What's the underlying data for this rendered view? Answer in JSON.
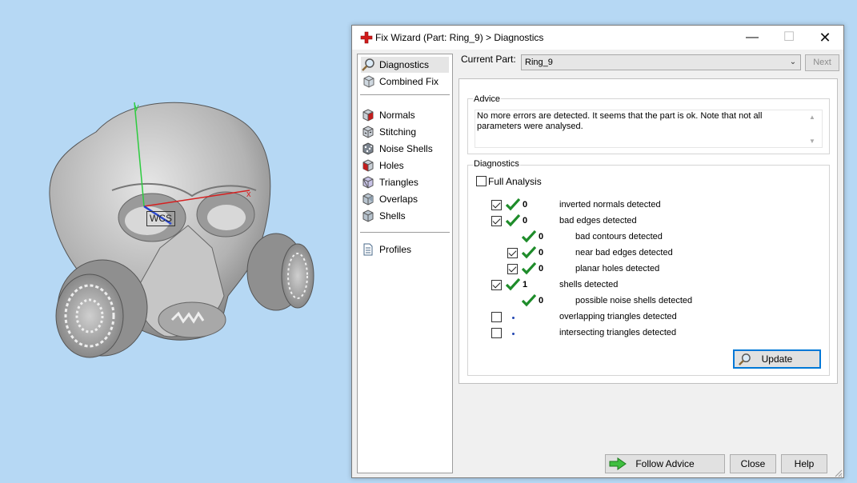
{
  "viewport": {
    "wcs_label": "WCS",
    "axis_x_label": "x",
    "axis_y_label": "y"
  },
  "dialog": {
    "title": "Fix Wizard (Part: Ring_9) > Diagnostics",
    "sidebar": {
      "group1": [
        {
          "label": "Diagnostics",
          "icon": "magnifier-icon",
          "selected": true
        },
        {
          "label": "Combined Fix",
          "icon": "cube-icon"
        }
      ],
      "group2": [
        {
          "label": "Normals",
          "icon": "normals-cube-icon"
        },
        {
          "label": "Stitching",
          "icon": "stitching-cube-icon"
        },
        {
          "label": "Noise Shells",
          "icon": "noise-shells-cube-icon"
        },
        {
          "label": "Holes",
          "icon": "holes-cube-icon"
        },
        {
          "label": "Triangles",
          "icon": "triangles-cube-icon"
        },
        {
          "label": "Overlaps",
          "icon": "overlaps-cube-icon"
        },
        {
          "label": "Shells",
          "icon": "shells-cube-icon"
        }
      ],
      "group3": [
        {
          "label": "Profiles",
          "icon": "document-icon"
        }
      ]
    },
    "current_part_label": "Current Part:",
    "current_part_value": "Ring_9",
    "next_label": "Next",
    "advice": {
      "title": "Advice",
      "text": "No more errors are detected. It seems that the part is ok. Note that not all parameters were analysed."
    },
    "diagnostics": {
      "title": "Diagnostics",
      "full_analysis_label": "Full Analysis",
      "full_analysis_checked": false,
      "rows": [
        {
          "label": "inverted normals detected",
          "count": "0",
          "status": "ok",
          "checkbox": true,
          "checked": true,
          "indent": 0
        },
        {
          "label": "bad edges detected",
          "count": "0",
          "status": "ok",
          "checkbox": true,
          "checked": true,
          "indent": 0
        },
        {
          "label": "bad contours detected",
          "count": "0",
          "status": "ok",
          "checkbox": false,
          "checked": false,
          "indent": 1
        },
        {
          "label": "near bad edges detected",
          "count": "0",
          "status": "ok",
          "checkbox": true,
          "checked": true,
          "indent": 1
        },
        {
          "label": "planar holes detected",
          "count": "0",
          "status": "ok",
          "checkbox": true,
          "checked": true,
          "indent": 1
        },
        {
          "label": "shells detected",
          "count": "1",
          "status": "ok",
          "checkbox": true,
          "checked": true,
          "indent": 0
        },
        {
          "label": "possible noise shells detected",
          "count": "0",
          "status": "ok",
          "checkbox": false,
          "checked": false,
          "indent": 1
        },
        {
          "label": "overlapping triangles detected",
          "count": "",
          "status": "pending",
          "checkbox": true,
          "checked": false,
          "indent": 0
        },
        {
          "label": "intersecting triangles detected",
          "count": "",
          "status": "pending",
          "checkbox": true,
          "checked": false,
          "indent": 0
        }
      ],
      "update_label": "Update"
    },
    "buttons": {
      "follow_advice": "Follow Advice",
      "close": "Close",
      "help": "Help"
    },
    "colors": {
      "check_green": "#1e8c2a",
      "accent_blue": "#0078d7",
      "title_icon_red": "#d11a1a"
    }
  }
}
